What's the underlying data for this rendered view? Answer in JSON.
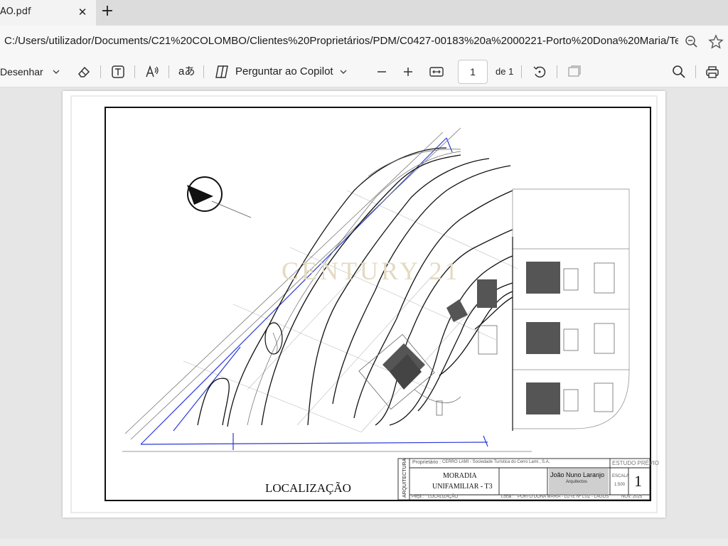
{
  "tab": {
    "title": "AO.pdf"
  },
  "address": {
    "url": "C:/Users/utilizador/Documents/C21%20COLOMBO/Clientes%20Proprietários/PDM/C0427-00183%20a%2000221-Porto%20Dona%20Maria/Ter..."
  },
  "toolbar": {
    "draw_label": "Desenhar",
    "copilot_label": "Perguntar ao Copilot",
    "page_number": "1",
    "page_total": "de 1"
  },
  "document": {
    "watermark": "CENTURY 21",
    "plan_title": "LOCALIZAÇÃO",
    "titleblock": {
      "side_label": "ARQUITECTURA",
      "owner_label": "Proprietário :",
      "owner_value": "CERRO LAMI - Sociedade Turística do Cerro Lami , S.A.",
      "status": "ESTUDO PRÉVIO",
      "project_line1": "MORADIA",
      "project_line2": "UNIFAMILIAR - T3",
      "architect_name": "João Nuno Laranjo",
      "architect_sub": "Arquitectos",
      "scale_label": "ESCALA",
      "scale_value": "1:500",
      "sheet_number": "1",
      "piece_label": "Peça :",
      "piece_value": "LOCALIZAÇÃO",
      "place_label": "Local :",
      "place_value": "PORTO DONA MARIA - LOTE Nº LUZ - LAGOS",
      "date_value": "NOV. 2025"
    }
  }
}
